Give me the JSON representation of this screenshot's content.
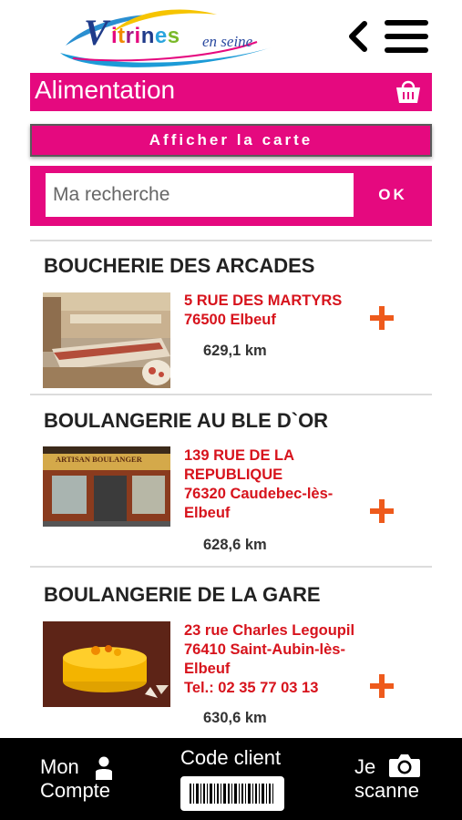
{
  "header": {
    "logo_letter": "V",
    "logo_main": "itrines",
    "logo_sub": "en seine",
    "back_icon": "chevron-left-icon",
    "menu_icon": "hamburger-menu-icon"
  },
  "category": {
    "title": "Alimentation",
    "icon": "shopping-basket-icon"
  },
  "map_button_label": "Afficher la carte",
  "search": {
    "placeholder": "Ma recherche",
    "value": "",
    "ok_label": "OK"
  },
  "shops": [
    {
      "name": "BOUCHERIE DES ARCADES",
      "address_lines": [
        "5 RUE DES MARTYRS",
        "76500 Elbeuf"
      ],
      "distance": "629,1 km"
    },
    {
      "name": "BOULANGERIE AU BLE D`OR",
      "address_lines": [
        "139 RUE DE LA",
        "REPUBLIQUE",
        "76320 Caudebec-lès-",
        "Elbeuf"
      ],
      "distance": "628,6 km",
      "sign_text": "ARTISAN BOULANGER"
    },
    {
      "name": "BOULANGERIE DE LA GARE",
      "address_lines": [
        "23 rue Charles Legoupil",
        "76410 Saint-Aubin-lès-",
        "Elbeuf",
        "Tel.: 02 35 77 03 13"
      ],
      "distance": "630,6 km"
    }
  ],
  "footer": {
    "account_line1": "Mon",
    "account_line2": "Compte",
    "code_label": "Code client",
    "scan_line1": "Je",
    "scan_line2": "scanne"
  },
  "colors": {
    "accent": "#e5097f",
    "address_red": "#d7131c",
    "plus_orange": "#ee5a1c",
    "footer_bg": "#000000"
  }
}
